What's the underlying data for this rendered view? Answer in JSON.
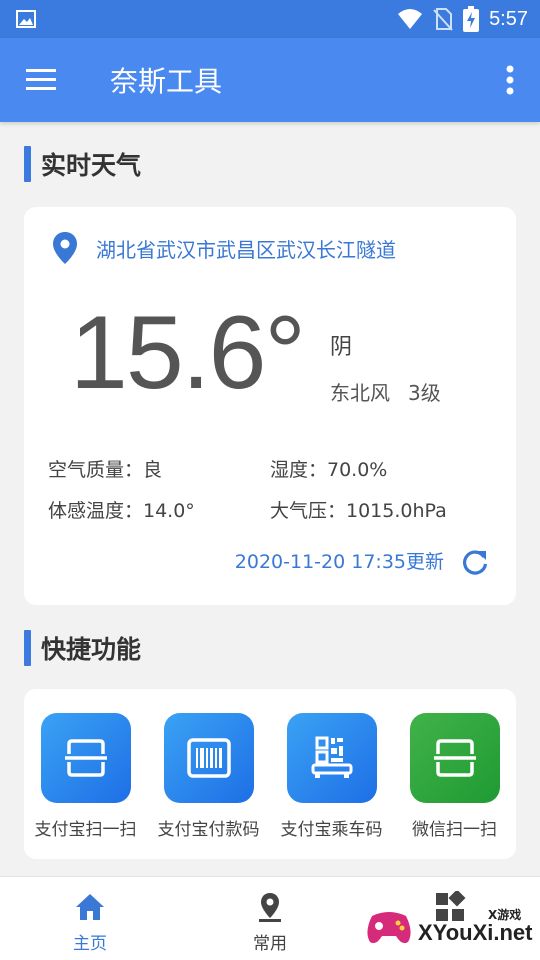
{
  "status_bar": {
    "time": "5:57",
    "icons": [
      "image-icon",
      "wifi-icon",
      "no-sim-icon",
      "battery-charging-icon"
    ]
  },
  "app_bar": {
    "title": "奈斯工具",
    "menu_icon": "hamburger-menu-icon",
    "more_icon": "more-vertical-icon"
  },
  "weather_section": {
    "header": "实时天气",
    "location": "湖北省武汉市武昌区武汉长江隧道",
    "temperature": "15.6°",
    "condition": "阴",
    "wind_direction": "东北风",
    "wind_level": "3级",
    "air_quality": "空气质量：良",
    "humidity": "湿度：70.0%",
    "feels_like": "体感温度：14.0°",
    "pressure": "大气压：1015.0hPa",
    "updated": "2020-11-20 17:35更新"
  },
  "shortcuts_section": {
    "header": "快捷功能",
    "items": [
      {
        "label": "支付宝扫一扫",
        "icon": "scan-icon",
        "color": "#2a8af0"
      },
      {
        "label": "支付宝付款码",
        "icon": "barcode-icon",
        "color": "#2a8af0"
      },
      {
        "label": "支付宝乘车码",
        "icon": "bus-qr-icon",
        "color": "#2a8af0"
      },
      {
        "label": "微信扫一扫",
        "icon": "scan-icon",
        "color": "#2aa63a"
      }
    ]
  },
  "bottom_nav": {
    "items": [
      {
        "label": "主页",
        "icon": "home-icon",
        "active": true
      },
      {
        "label": "常用",
        "icon": "location-pin-icon",
        "active": false
      },
      {
        "label": "",
        "icon": "apps-icon",
        "active": false
      }
    ]
  },
  "watermark": {
    "small": "X游戏",
    "big": "XYouXi.net"
  },
  "colors": {
    "accent": "#3b7be0",
    "app_bar": "#4a8af0",
    "link": "#3a78d6"
  }
}
